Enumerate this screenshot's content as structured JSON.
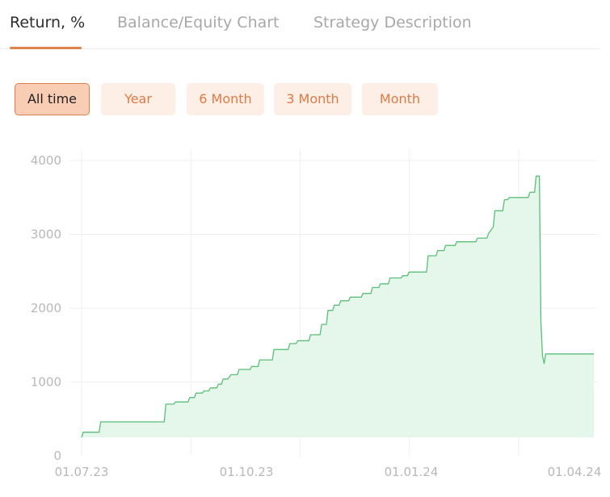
{
  "tabs": [
    {
      "label": "Return, %",
      "active": true
    },
    {
      "label": "Balance/Equity Chart",
      "active": false
    },
    {
      "label": "Strategy Description",
      "active": false
    }
  ],
  "periods": [
    {
      "label": "All time",
      "active": true
    },
    {
      "label": "Year",
      "active": false
    },
    {
      "label": "6 Month",
      "active": false
    },
    {
      "label": "3 Month",
      "active": false
    },
    {
      "label": "Month",
      "active": false
    }
  ],
  "colors": {
    "accent": "#e2834c",
    "line": "#5bbf78",
    "fill": "#e5f6ea",
    "grid": "#efefef",
    "tick_text": "#b8b8b8"
  },
  "chart_data": {
    "type": "area",
    "title": "",
    "xlabel": "",
    "ylabel": "",
    "ylim": [
      0,
      4000
    ],
    "y_ticks": [
      0,
      1000,
      2000,
      3000,
      4000
    ],
    "y_tick_labels": [
      "0",
      "1000",
      "2000",
      "3000",
      "4000"
    ],
    "x_ticks": [
      {
        "label": "01.07.23",
        "date": "2023-07-01"
      },
      {
        "label": "01.10.23",
        "date": "2023-10-01"
      },
      {
        "label": "01.01.24",
        "date": "2024-01-01"
      },
      {
        "label": "01.04.24",
        "date": "2024-04-01"
      }
    ],
    "xlim": [
      "2023-07-01",
      "2024-04-01"
    ],
    "grid": true,
    "baseline": 250,
    "series": [
      {
        "points": [
          [
            "2023-07-01",
            250
          ],
          [
            "2023-07-02",
            320
          ],
          [
            "2023-07-12",
            320
          ],
          [
            "2023-07-13",
            460
          ],
          [
            "2023-08-22",
            460
          ],
          [
            "2023-08-23",
            700
          ],
          [
            "2023-08-28",
            700
          ],
          [
            "2023-08-29",
            730
          ],
          [
            "2023-09-06",
            730
          ],
          [
            "2023-09-07",
            790
          ],
          [
            "2023-09-10",
            790
          ],
          [
            "2023-09-11",
            850
          ],
          [
            "2023-09-15",
            850
          ],
          [
            "2023-09-16",
            880
          ],
          [
            "2023-09-19",
            880
          ],
          [
            "2023-09-20",
            920
          ],
          [
            "2023-09-24",
            920
          ],
          [
            "2023-09-25",
            970
          ],
          [
            "2023-09-27",
            970
          ],
          [
            "2023-09-28",
            1040
          ],
          [
            "2023-10-01",
            1040
          ],
          [
            "2023-10-03",
            1100
          ],
          [
            "2023-10-07",
            1100
          ],
          [
            "2023-10-08",
            1170
          ],
          [
            "2023-10-15",
            1170
          ],
          [
            "2023-10-16",
            1210
          ],
          [
            "2023-10-20",
            1210
          ],
          [
            "2023-10-21",
            1300
          ],
          [
            "2023-10-29",
            1300
          ],
          [
            "2023-10-30",
            1440
          ],
          [
            "2023-11-08",
            1440
          ],
          [
            "2023-11-09",
            1520
          ],
          [
            "2023-11-13",
            1520
          ],
          [
            "2023-11-14",
            1560
          ],
          [
            "2023-11-21",
            1560
          ],
          [
            "2023-11-22",
            1640
          ],
          [
            "2023-11-28",
            1640
          ],
          [
            "2023-11-29",
            1780
          ],
          [
            "2023-12-02",
            1780
          ],
          [
            "2023-12-03",
            1970
          ],
          [
            "2023-12-06",
            1970
          ],
          [
            "2023-12-07",
            2040
          ],
          [
            "2023-12-10",
            2040
          ],
          [
            "2023-12-11",
            2100
          ],
          [
            "2023-12-16",
            2100
          ],
          [
            "2023-12-17",
            2150
          ],
          [
            "2023-12-24",
            2150
          ],
          [
            "2023-12-25",
            2200
          ],
          [
            "2023-12-30",
            2200
          ],
          [
            "2023-12-31",
            2280
          ],
          [
            "2024-01-04",
            2280
          ],
          [
            "2024-01-05",
            2330
          ],
          [
            "2024-01-10",
            2330
          ],
          [
            "2024-01-11",
            2410
          ],
          [
            "2024-01-18",
            2410
          ],
          [
            "2024-01-19",
            2440
          ],
          [
            "2024-01-22",
            2440
          ],
          [
            "2024-01-23",
            2490
          ],
          [
            "2024-02-03",
            2490
          ],
          [
            "2024-02-04",
            2710
          ],
          [
            "2024-02-09",
            2710
          ],
          [
            "2024-02-10",
            2780
          ],
          [
            "2024-02-14",
            2780
          ],
          [
            "2024-02-15",
            2850
          ],
          [
            "2024-02-21",
            2850
          ],
          [
            "2024-02-22",
            2900
          ],
          [
            "2024-03-05",
            2900
          ],
          [
            "2024-03-06",
            2950
          ],
          [
            "2024-03-12",
            2950
          ],
          [
            "2024-03-13",
            3010
          ],
          [
            "2024-03-16",
            3100
          ],
          [
            "2024-03-17",
            3320
          ],
          [
            "2024-03-22",
            3320
          ],
          [
            "2024-03-23",
            3470
          ],
          [
            "2024-03-25",
            3470
          ],
          [
            "2024-03-26",
            3500
          ],
          [
            "2024-04-07",
            3500
          ],
          [
            "2024-04-08",
            3570
          ],
          [
            "2024-04-11",
            3570
          ],
          [
            "2024-04-12",
            3790
          ],
          [
            "2024-04-14",
            3790
          ],
          [
            "2024-04-15",
            1800
          ],
          [
            "2024-04-16",
            1350
          ],
          [
            "2024-04-17",
            1250
          ],
          [
            "2024-04-18",
            1380
          ],
          [
            "2024-05-18",
            1380
          ]
        ]
      }
    ]
  }
}
